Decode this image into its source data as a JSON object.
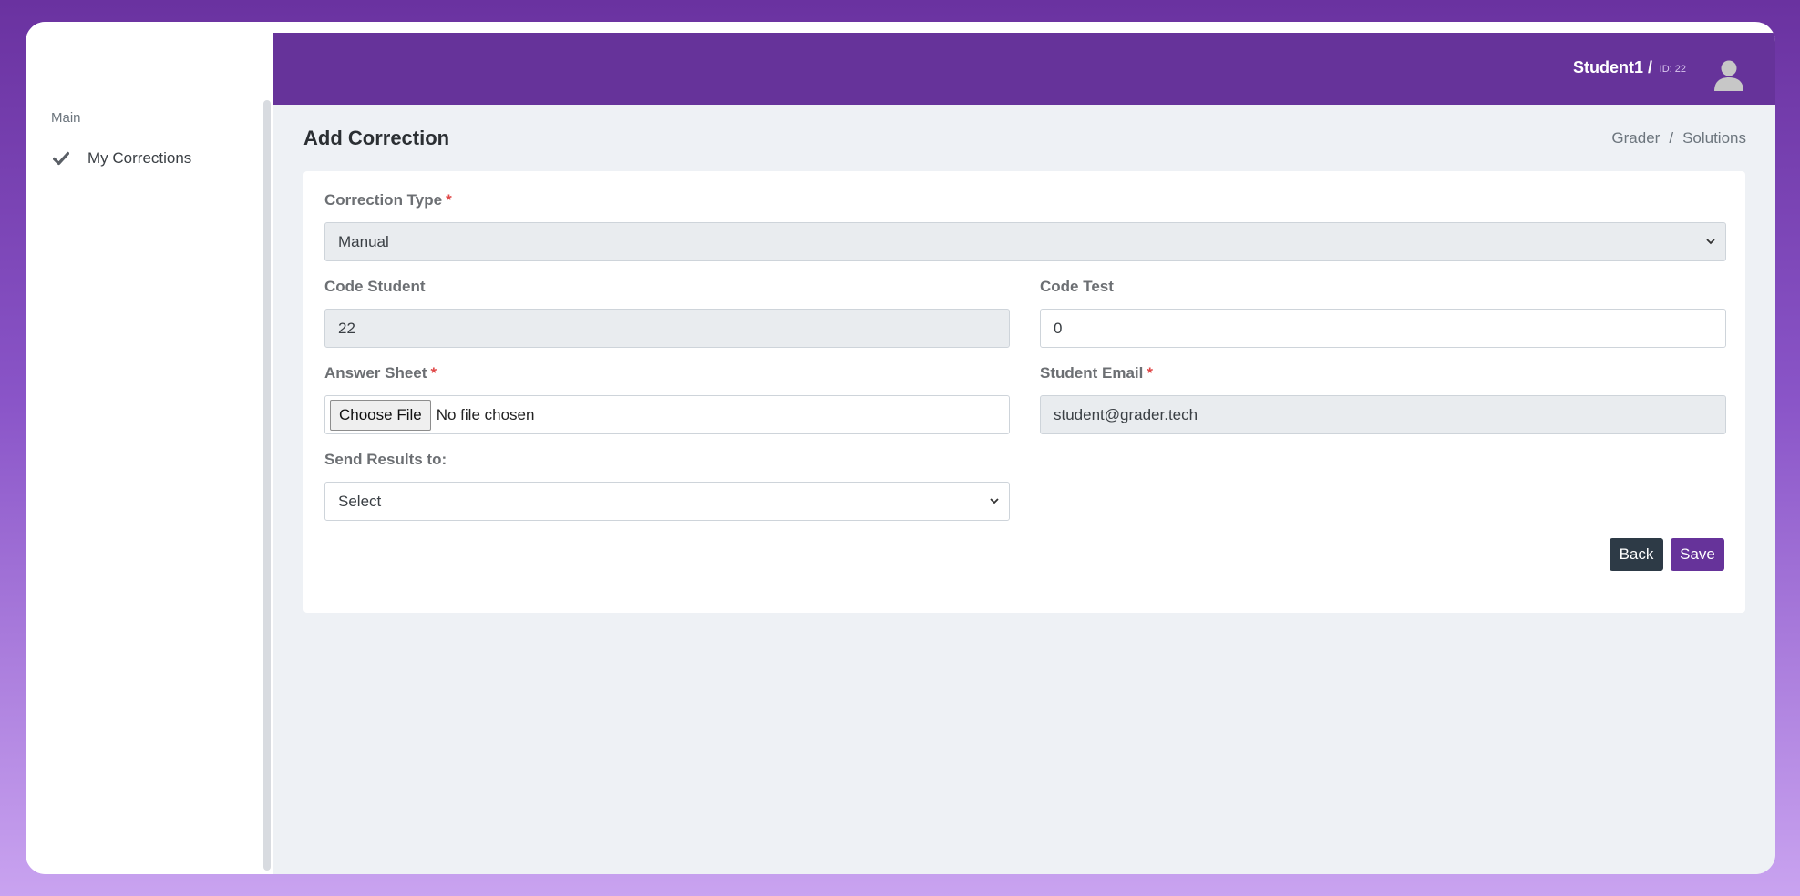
{
  "colors": {
    "primary": "#66339a",
    "back_button": "#2d3a46",
    "required_mark": "#e04848",
    "page_background": "#eef1f5"
  },
  "sidebar": {
    "section_title": "Main",
    "items": [
      {
        "label": "My Corrections",
        "icon": "check-icon"
      }
    ]
  },
  "header": {
    "user_name": "Student1 /",
    "user_id": "ID: 22",
    "avatar_icon": "user-avatar-icon"
  },
  "page": {
    "title": "Add Correction",
    "breadcrumb": [
      "Grader",
      "Solutions"
    ]
  },
  "form": {
    "correction_type": {
      "label": "Correction Type",
      "required_mark": "*",
      "value": "Manual"
    },
    "code_student": {
      "label": "Code Student",
      "value": "22"
    },
    "code_test": {
      "label": "Code Test",
      "value": "0"
    },
    "answer_sheet": {
      "label": "Answer Sheet",
      "required_mark": "*",
      "button_label": "Choose File",
      "status": "No file chosen"
    },
    "student_email": {
      "label": "Student Email",
      "required_mark": "*",
      "value": "student@grader.tech"
    },
    "send_results_to": {
      "label": "Send Results to:",
      "value": "Select"
    },
    "back_label": "Back",
    "save_label": "Save"
  }
}
